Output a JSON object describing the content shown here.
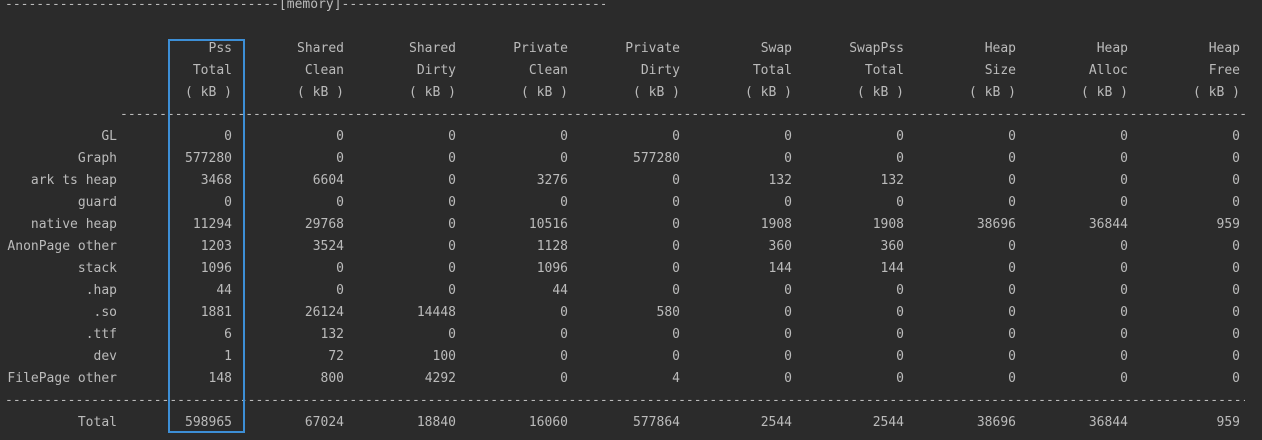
{
  "section_title": "[memory]",
  "header": {
    "columns": [
      {
        "line1": "Pss",
        "line2": "Total",
        "unit": "( kB )"
      },
      {
        "line1": "Shared",
        "line2": "Clean",
        "unit": "( kB )"
      },
      {
        "line1": "Shared",
        "line2": "Dirty",
        "unit": "( kB )"
      },
      {
        "line1": "Private",
        "line2": "Clean",
        "unit": "( kB )"
      },
      {
        "line1": "Private",
        "line2": "Dirty",
        "unit": "( kB )"
      },
      {
        "line1": "Swap",
        "line2": "Total",
        "unit": "( kB )"
      },
      {
        "line1": "SwapPss",
        "line2": "Total",
        "unit": "( kB )"
      },
      {
        "line1": "Heap",
        "line2": "Size",
        "unit": "( kB )"
      },
      {
        "line1": "Heap",
        "line2": "Alloc",
        "unit": "( kB )"
      },
      {
        "line1": "Heap",
        "line2": "Free",
        "unit": "( kB )"
      }
    ]
  },
  "rows": [
    {
      "label": "GL",
      "values": [
        "0",
        "0",
        "0",
        "0",
        "0",
        "0",
        "0",
        "0",
        "0",
        "0"
      ]
    },
    {
      "label": "Graph",
      "values": [
        "577280",
        "0",
        "0",
        "0",
        "577280",
        "0",
        "0",
        "0",
        "0",
        "0"
      ]
    },
    {
      "label": "ark ts heap",
      "values": [
        "3468",
        "6604",
        "0",
        "3276",
        "0",
        "132",
        "132",
        "0",
        "0",
        "0"
      ]
    },
    {
      "label": "guard",
      "values": [
        "0",
        "0",
        "0",
        "0",
        "0",
        "0",
        "0",
        "0",
        "0",
        "0"
      ]
    },
    {
      "label": "native heap",
      "values": [
        "11294",
        "29768",
        "0",
        "10516",
        "0",
        "1908",
        "1908",
        "38696",
        "36844",
        "959"
      ]
    },
    {
      "label": "AnonPage other",
      "values": [
        "1203",
        "3524",
        "0",
        "1128",
        "0",
        "360",
        "360",
        "0",
        "0",
        "0"
      ]
    },
    {
      "label": "stack",
      "values": [
        "1096",
        "0",
        "0",
        "1096",
        "0",
        "144",
        "144",
        "0",
        "0",
        "0"
      ]
    },
    {
      "label": ".hap",
      "values": [
        "44",
        "0",
        "0",
        "44",
        "0",
        "0",
        "0",
        "0",
        "0",
        "0"
      ]
    },
    {
      "label": ".so",
      "values": [
        "1881",
        "26124",
        "14448",
        "0",
        "580",
        "0",
        "0",
        "0",
        "0",
        "0"
      ]
    },
    {
      "label": ".ttf",
      "values": [
        "6",
        "132",
        "0",
        "0",
        "0",
        "0",
        "0",
        "0",
        "0",
        "0"
      ]
    },
    {
      "label": "dev",
      "values": [
        "1",
        "72",
        "100",
        "0",
        "0",
        "0",
        "0",
        "0",
        "0",
        "0"
      ]
    },
    {
      "label": "FilePage other",
      "values": [
        "148",
        "800",
        "4292",
        "0",
        "4",
        "0",
        "0",
        "0",
        "0",
        "0"
      ]
    }
  ],
  "total": {
    "label": "Total",
    "values": [
      "598965",
      "67024",
      "18840",
      "16060",
      "577864",
      "2544",
      "2544",
      "38696",
      "36844",
      "959"
    ]
  },
  "colors": {
    "background": "#2b2b2b",
    "text": "#bbbbbb",
    "highlight_border": "#3d8fd6"
  }
}
